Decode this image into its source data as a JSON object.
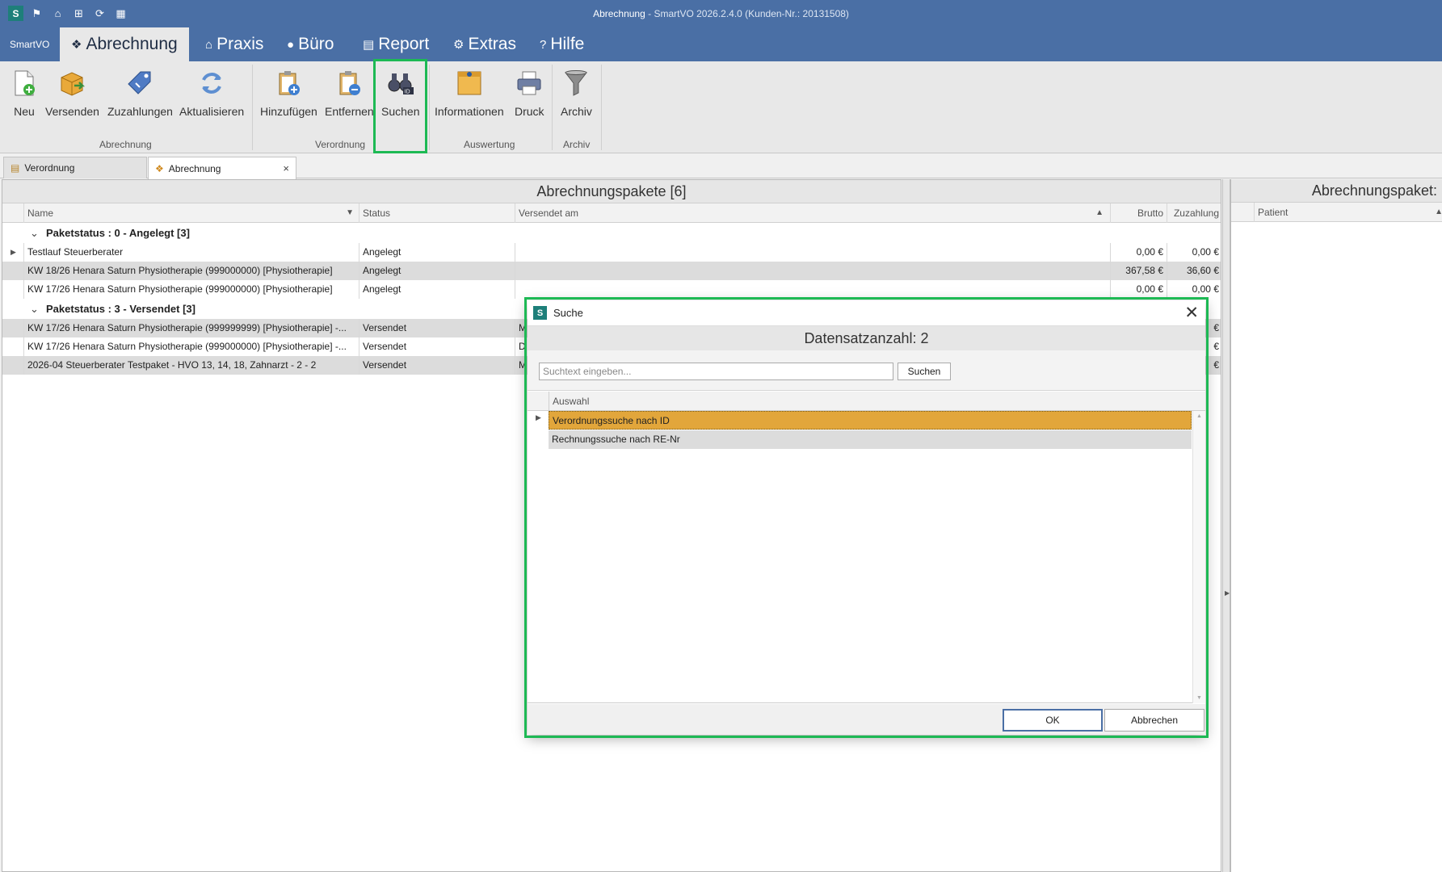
{
  "titlebar": {
    "title_strong": "Abrechnung",
    "title_weak": " - SmartVO 2026.2.4.0 (Kunden-Nr.: 20131508)",
    "app_icon_letter": "S",
    "quick_icons": [
      "flag-icon",
      "home-icon",
      "network-icon",
      "refresh-icon",
      "calendar-icon"
    ]
  },
  "menu": {
    "smartvo": "SmartVO",
    "abrechnung": "Abrechnung",
    "praxis": "Praxis",
    "buero": "Büro",
    "report": "Report",
    "extras": "Extras",
    "hilfe": "Hilfe",
    "hilfe_icon": "?"
  },
  "ribbon": {
    "neu": "Neu",
    "versenden": "Versenden",
    "zuzahlungen": "Zuzahlungen",
    "aktualisieren": "Aktualisieren",
    "hinzufuegen": "Hinzufügen",
    "entfernen": "Entfernen",
    "suchen": "Suchen",
    "informationen": "Informationen",
    "druck": "Druck",
    "archiv": "Archiv",
    "groups": {
      "abrechnung": "Abrechnung",
      "verordnung": "Verordnung",
      "auswertung": "Auswertung",
      "archiv": "Archiv"
    }
  },
  "doctabs": {
    "verordnung": "Verordnung",
    "abrechnung": "Abrechnung",
    "close": "×"
  },
  "main": {
    "title": "Abrechnungspakete [6]",
    "columns": {
      "name": "Name",
      "status": "Status",
      "versendet_am": "Versendet am",
      "brutto": "Brutto",
      "zuzahlung": "Zuzahlung"
    },
    "groups": [
      {
        "label": "Paketstatus : 0 - Angelegt [3]",
        "rows": [
          {
            "name": "Testlauf Steuerberater",
            "status": "Angelegt",
            "versendet": "",
            "brutto": "0,00 €",
            "zuzahlung": "0,00 €"
          },
          {
            "name": "KW 18/26  Henara Saturn Physiotherapie (999000000) [Physiotherapie]",
            "status": "Angelegt",
            "versendet": "",
            "brutto": "367,58 €",
            "zuzahlung": "36,60 €"
          },
          {
            "name": "KW 17/26  Henara Saturn Physiotherapie (999000000) [Physiotherapie]",
            "status": "Angelegt",
            "versendet": "",
            "brutto": "0,00 €",
            "zuzahlung": "0,00 €"
          }
        ]
      },
      {
        "label": "Paketstatus : 3 - Versendet [3]",
        "rows": [
          {
            "name": "KW 17/26  Henara Saturn Physiotherapie (999999999) [Physiotherapie] -...",
            "status": "Versendet",
            "versendet": "M",
            "brutto": "",
            "zuzahlung": "€"
          },
          {
            "name": "KW 17/26  Henara Saturn Physiotherapie (999000000) [Physiotherapie] -...",
            "status": "Versendet",
            "versendet": "D",
            "brutto": "",
            "zuzahlung": "€"
          },
          {
            "name": "2026-04 Steuerberater Testpaket - HVO 13, 14, 18, Zahnarzt - 2 - 2",
            "status": "Versendet",
            "versendet": "M",
            "brutto": "",
            "zuzahlung": "€"
          }
        ]
      }
    ]
  },
  "right": {
    "title": "Abrechnungspaket:",
    "col_patient": "Patient"
  },
  "dialog": {
    "app_icon_letter": "S",
    "title": "Suche",
    "close": "✕",
    "count": "Datensatzanzahl: 2",
    "search_placeholder": "Suchtext eingeben...",
    "search_button": "Suchen",
    "column": "Auswahl",
    "rows": [
      "Verordnungssuche nach ID",
      "Rechnungssuche nach RE-Nr"
    ],
    "ok": "OK",
    "cancel": "Abbrechen"
  },
  "colors": {
    "titlebar": "#4a6fa5",
    "highlight": "#1db954",
    "selection": "#e2a63b"
  }
}
